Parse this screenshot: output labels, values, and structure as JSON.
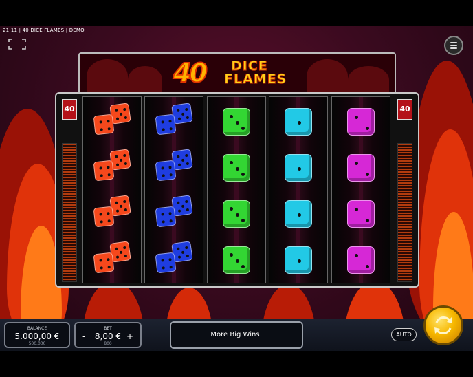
{
  "status": {
    "text": "21:11 | 40 DICE FLAMES | DEMO"
  },
  "logo": {
    "number": "40",
    "word1": "DICE",
    "word2": "FLAMES"
  },
  "paylines": {
    "left": "40",
    "right": "40"
  },
  "balance": {
    "label": "BALANCE",
    "value": "5.000,00 €",
    "sub": "500.000"
  },
  "bet": {
    "label": "BET",
    "minus": "-",
    "value": "8,00 €",
    "plus": "+",
    "sub": "800"
  },
  "message": "More Big Wins!",
  "auto_label": "AUTO",
  "reels": [
    {
      "color": "#f5481c",
      "type": "double",
      "symbols": [
        "double-dice",
        "double-dice",
        "double-dice",
        "double-dice"
      ]
    },
    {
      "color": "#1f3de0",
      "type": "double",
      "symbols": [
        "double-dice",
        "double-dice",
        "double-dice",
        "double-dice"
      ]
    },
    {
      "color": "#33d633",
      "type": "single",
      "pips": 3,
      "symbols": [
        "three",
        "three",
        "three",
        "three"
      ]
    },
    {
      "color": "#22c9e6",
      "type": "single",
      "pips": 1,
      "symbols": [
        "one",
        "one",
        "one",
        "one"
      ]
    },
    {
      "color": "#d628d6",
      "type": "single",
      "pips": 2,
      "symbols": [
        "two",
        "two",
        "two",
        "two"
      ]
    }
  ],
  "colors": {
    "accent": "#ffb300",
    "badge": "#b4121a",
    "spin": "#f7b800"
  },
  "icons": {
    "fullscreen": "fullscreen-icon",
    "menu": "hamburger-menu-icon",
    "spin": "spin-arrows-icon"
  }
}
